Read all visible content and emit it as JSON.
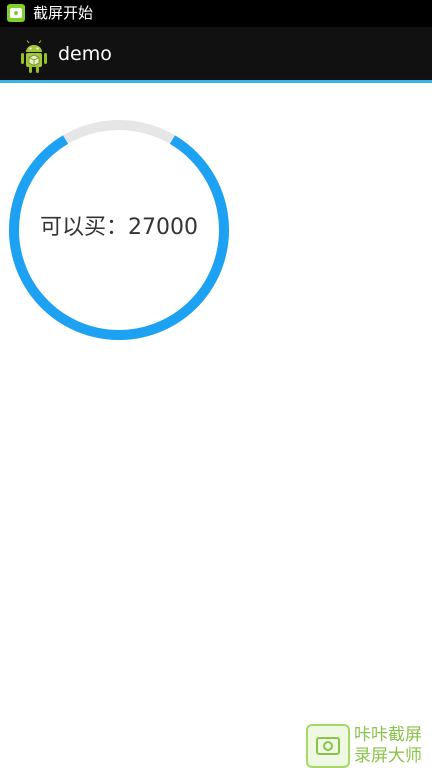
{
  "status_bar": {
    "notification_icon": "screenshot-app-icon",
    "notification_text": "截屏开始"
  },
  "action_bar": {
    "app_icon": "android-icon",
    "title": "demo"
  },
  "progress": {
    "label": "可以买：27000",
    "fraction": 0.83,
    "track_color": "#e6e6e6",
    "fill_color": "#1da1f2"
  },
  "watermark": {
    "icon": "camera-icon",
    "line1": "咔咔截屏",
    "line2": "录屏大师",
    "color": "#8bc34a"
  },
  "colors": {
    "status_bar_bg": "#000000",
    "action_bar_bg": "#111111",
    "action_bar_accent": "#33b5e5"
  }
}
